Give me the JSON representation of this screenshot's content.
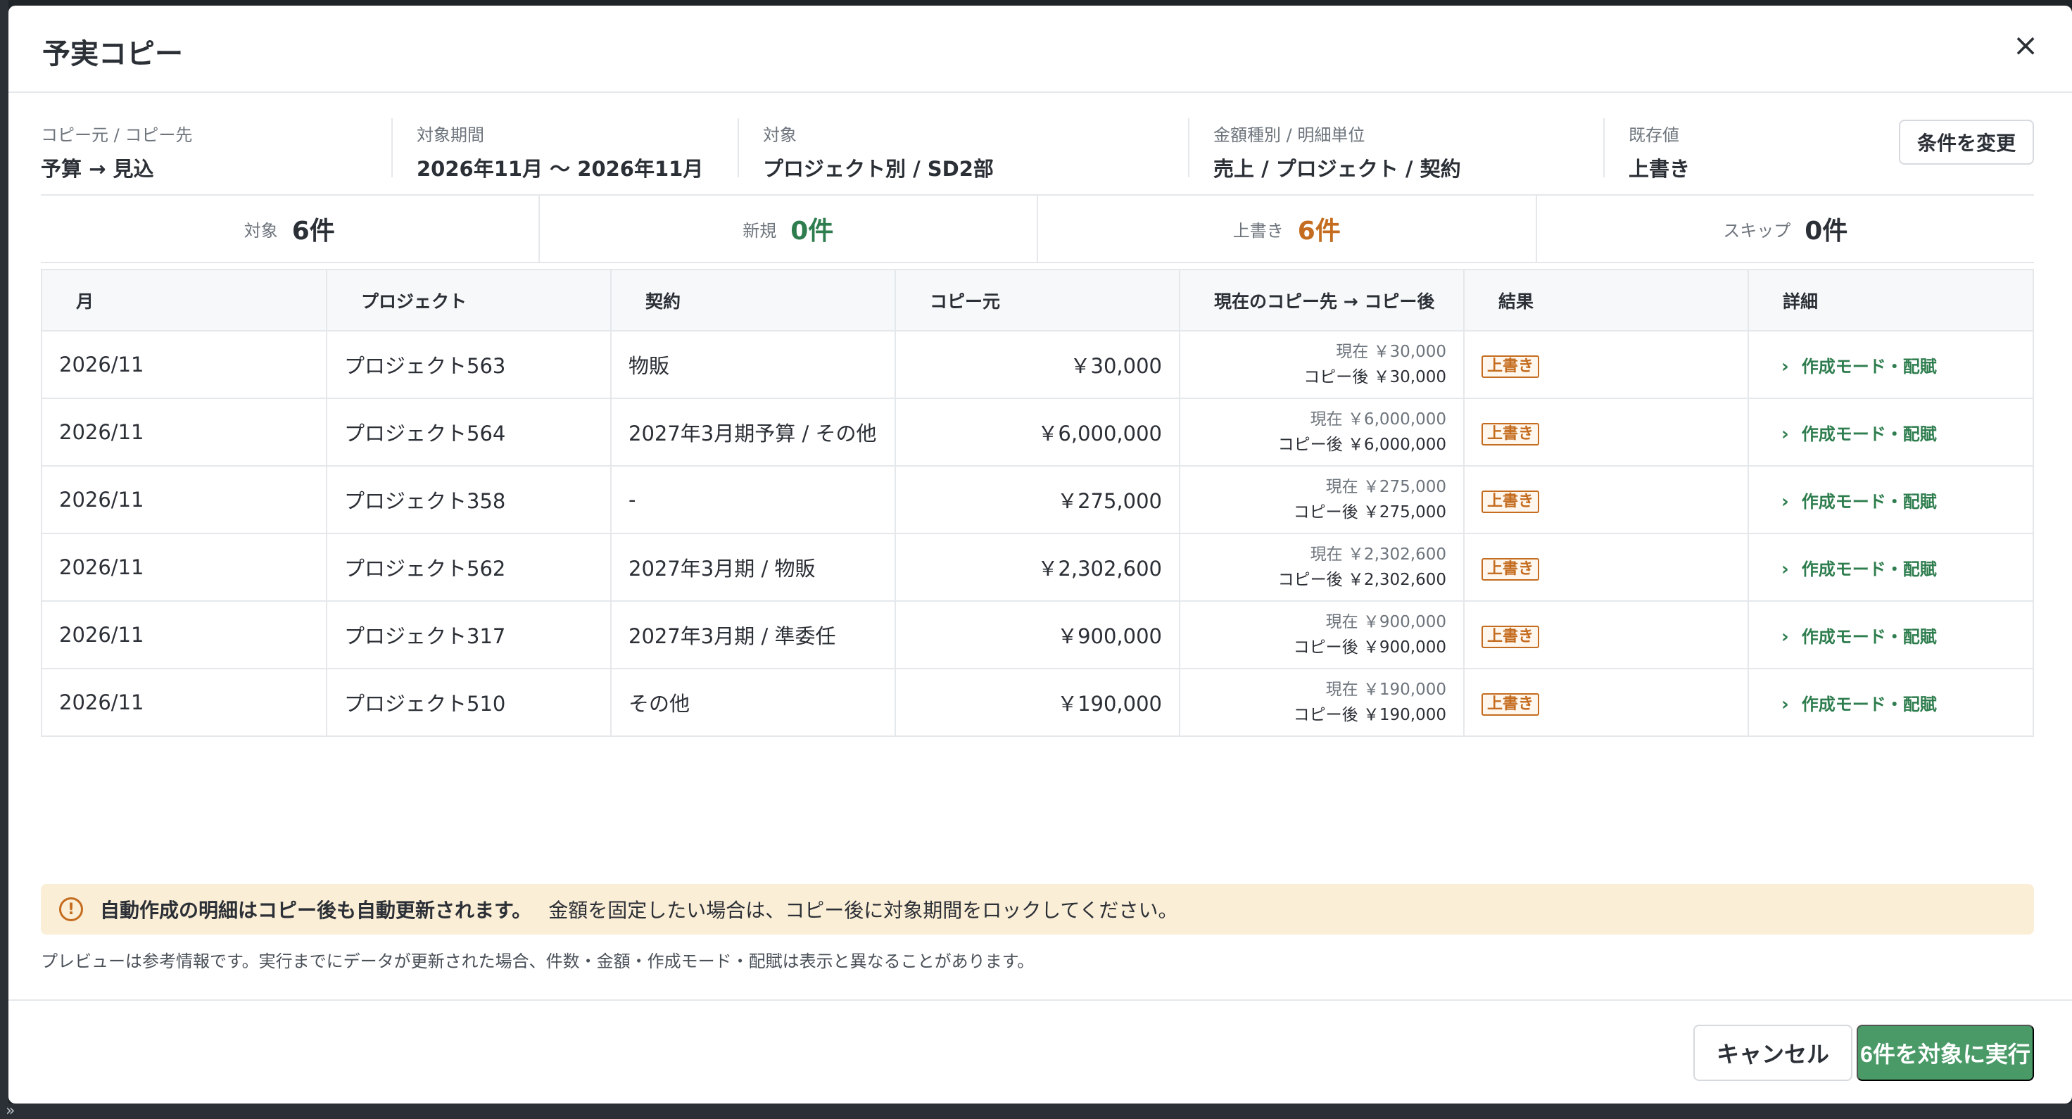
{
  "dialog": {
    "title": "予実コピー",
    "close_icon": "×"
  },
  "conditions": [
    {
      "label": "コピー元 / コピー先",
      "value": "予算 → 見込"
    },
    {
      "label": "対象期間",
      "value": "2026年11月 〜 2026年11月"
    },
    {
      "label": "対象",
      "value": "プロジェクト別 / SD2部"
    },
    {
      "label": "金額種別 / 明細単位",
      "value": "売上 / プロジェクト / 契約"
    },
    {
      "label": "既存値",
      "value": "上書き"
    }
  ],
  "change_button": "条件を変更",
  "summary": [
    {
      "label": "対象",
      "value": "6件",
      "color": "#2b2f36"
    },
    {
      "label": "新規",
      "value": "0件",
      "color": "#2e7d4e"
    },
    {
      "label": "上書き",
      "value": "6件",
      "color": "#c46c1f"
    },
    {
      "label": "スキップ",
      "value": "0件",
      "color": "#2b2f36"
    }
  ],
  "table": {
    "headers": [
      "月",
      "プロジェクト",
      "契約",
      "コピー元",
      "現在のコピー先 → コピー後",
      "結果",
      "詳細"
    ],
    "rows": [
      {
        "month": "2026/11",
        "project": "プロジェクト563",
        "contract": "物販",
        "source": "￥30,000",
        "current": "現在 ￥30,000",
        "after": "コピー後 ￥30,000",
        "result": "上書き",
        "detail": "作成モード・配賦"
      },
      {
        "month": "2026/11",
        "project": "プロジェクト564",
        "contract": "2027年3月期予算 / その他",
        "source": "￥6,000,000",
        "current": "現在 ￥6,000,000",
        "after": "コピー後 ￥6,000,000",
        "result": "上書き",
        "detail": "作成モード・配賦"
      },
      {
        "month": "2026/11",
        "project": "プロジェクト358",
        "contract": "-",
        "source": "￥275,000",
        "current": "現在 ￥275,000",
        "after": "コピー後 ￥275,000",
        "result": "上書き",
        "detail": "作成モード・配賦"
      },
      {
        "month": "2026/11",
        "project": "プロジェクト562",
        "contract": "2027年3月期 / 物販",
        "source": "￥2,302,600",
        "current": "現在 ￥2,302,600",
        "after": "コピー後 ￥2,302,600",
        "result": "上書き",
        "detail": "作成モード・配賦"
      },
      {
        "month": "2026/11",
        "project": "プロジェクト317",
        "contract": "2027年3月期 / 準委任",
        "source": "￥900,000",
        "current": "現在 ￥900,000",
        "after": "コピー後 ￥900,000",
        "result": "上書き",
        "detail": "作成モード・配賦"
      },
      {
        "month": "2026/11",
        "project": "プロジェクト510",
        "contract": "その他",
        "source": "￥190,000",
        "current": "現在 ￥190,000",
        "after": "コピー後 ￥190,000",
        "result": "上書き",
        "detail": "作成モード・配賦"
      }
    ]
  },
  "warning": {
    "icon": "!",
    "strong": "自動作成の明細はコピー後も自動更新されます。",
    "text": "金額を固定したい場合は、コピー後に対象期間をロックしてください。"
  },
  "note": "プレビューは参考情報です。実行までにデータが更新された場合、件数・金額・作成モード・配賦は表示と異なることがあります。",
  "footer": {
    "cancel": "キャンセル",
    "run": "6件を対象に実行"
  },
  "backdrop": {
    "expand_icon": "»"
  },
  "colors": {
    "accent": "#4a9a68",
    "overwrite": "#c46c1f",
    "new": "#2e7d4e",
    "warning_bg": "#fbeed6"
  }
}
